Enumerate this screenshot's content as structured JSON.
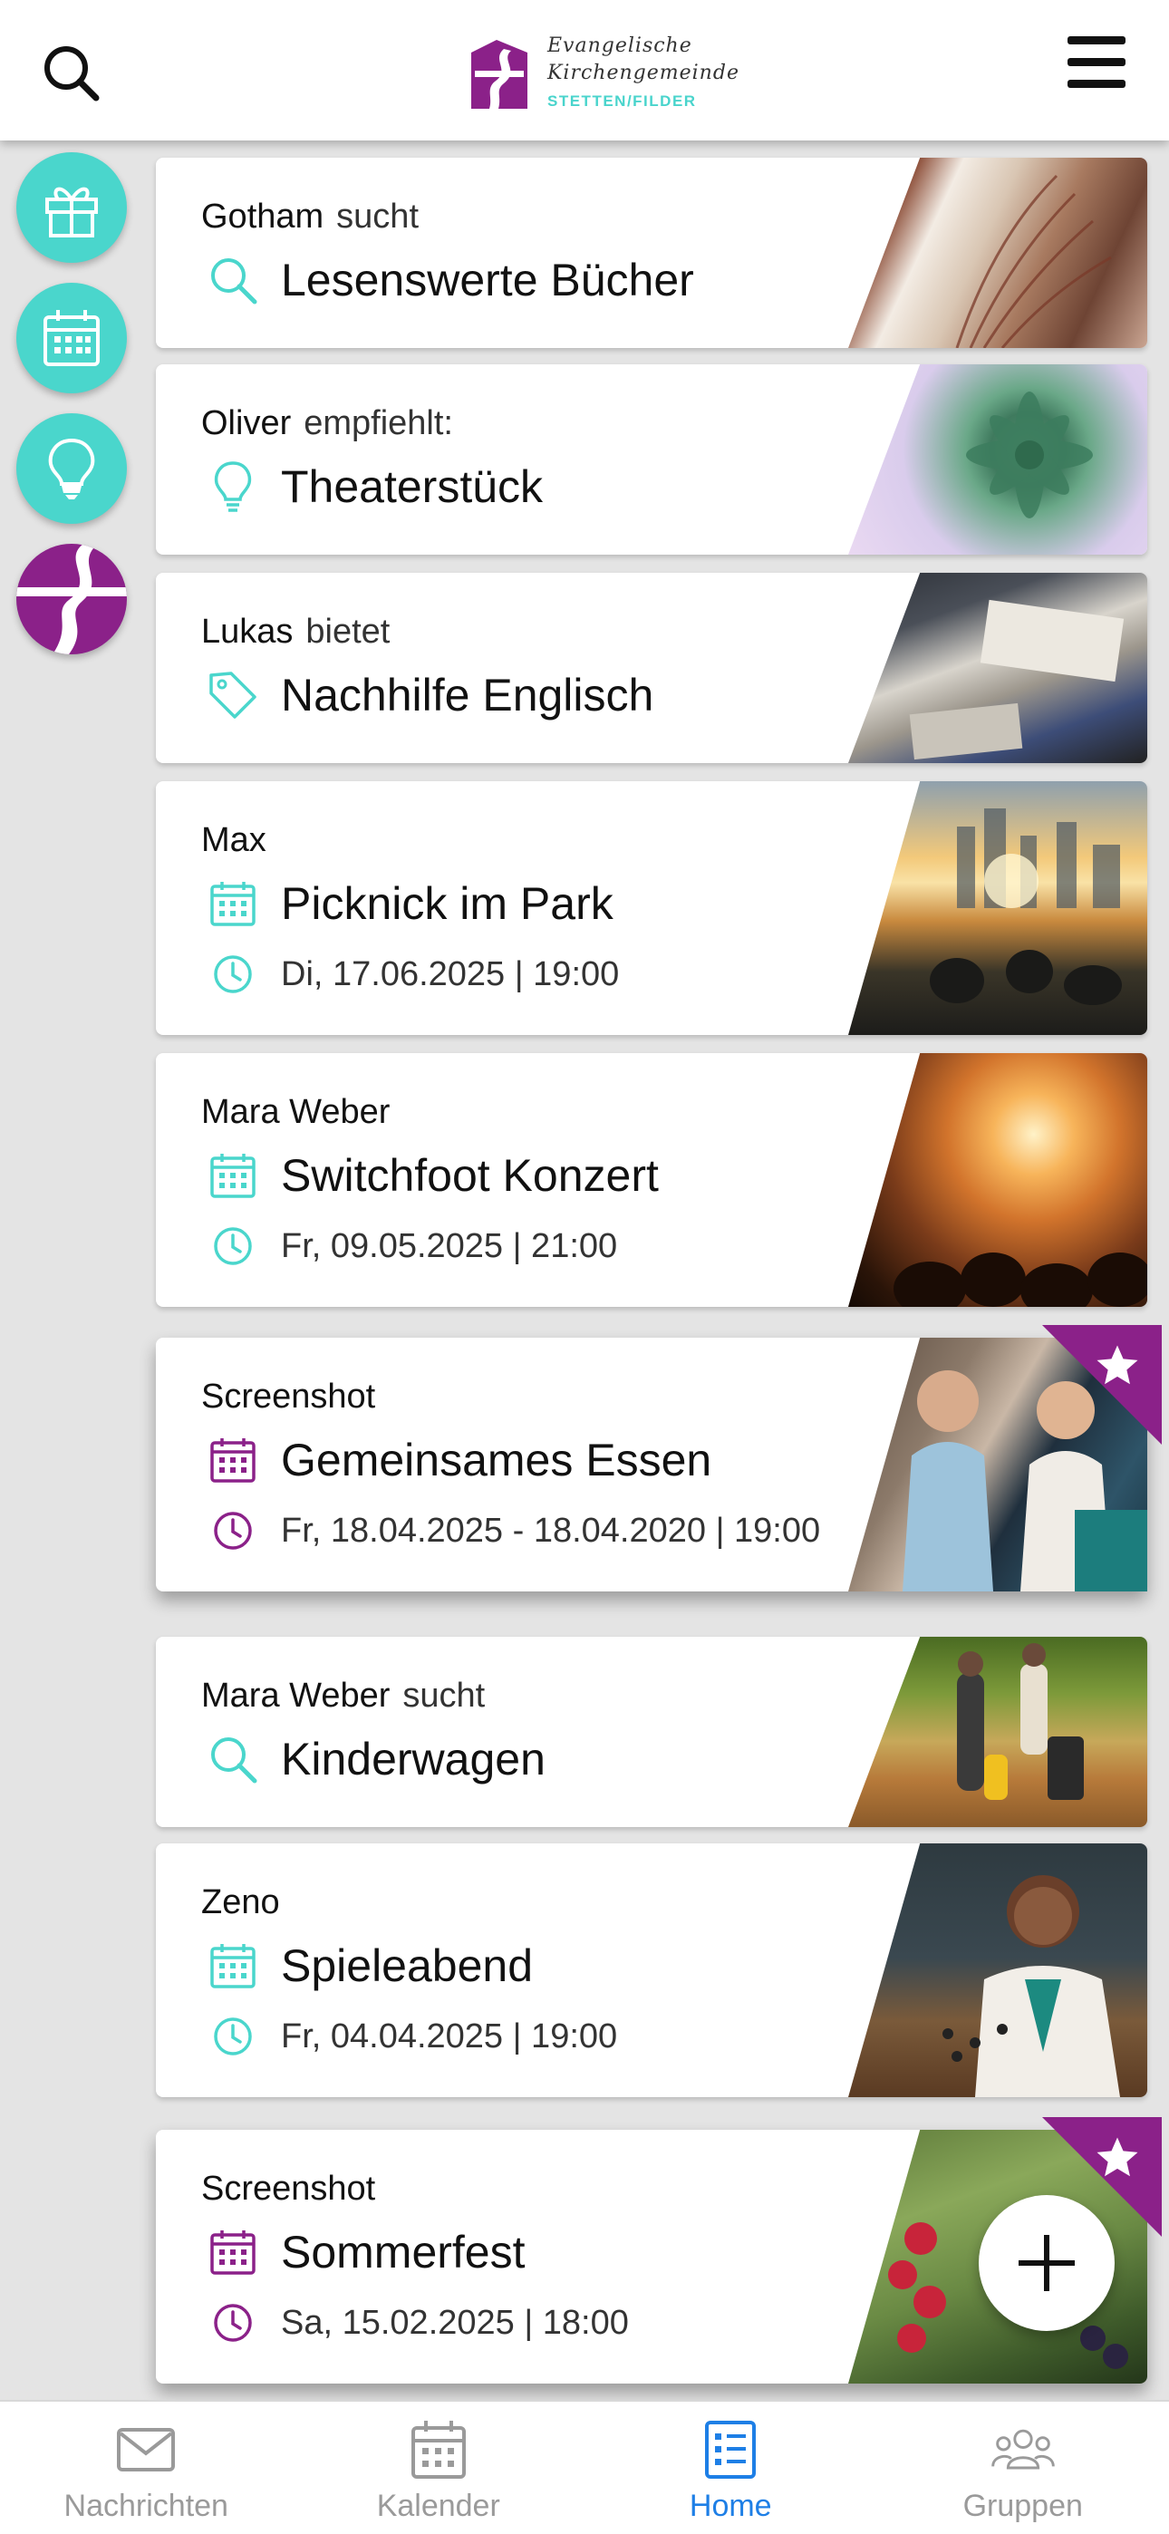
{
  "header": {
    "logo_line1": "Evangelische",
    "logo_line2": "Kirchengemeinde",
    "logo_line3": "STETTEN/FILDER"
  },
  "colors": {
    "teal": "#4ad6cc",
    "purple": "#8b2189",
    "active_blue": "#1e7fe6",
    "inactive_gray": "#9a9a9a"
  },
  "side_filters": [
    "gift-icon",
    "calendar-icon",
    "lightbulb-icon",
    "church-logo-icon"
  ],
  "cards": [
    {
      "author": "Gotham",
      "verb": "sucht",
      "title": "Lesenswerte Bücher",
      "icon": "search-icon"
    },
    {
      "author": "Oliver",
      "verb": "empfiehlt:",
      "title": "Theaterstück",
      "icon": "lightbulb-icon"
    },
    {
      "author": "Lukas",
      "verb": "bietet",
      "title": "Nachhilfe Englisch",
      "icon": "tag-icon"
    },
    {
      "author": "Max",
      "title": "Picknick im Park",
      "date": "Di, 17.06.2025 | 19:00",
      "icon": "calendar-icon"
    },
    {
      "author": "Mara Weber",
      "title": "Switchfoot Konzert",
      "date": "Fr, 09.05.2025 | 21:00",
      "icon": "calendar-icon"
    },
    {
      "author": "Screenshot",
      "title": "Gemeinsames Essen",
      "date": "Fr, 18.04.2025 - 18.04.2020 | 19:00",
      "icon": "calendar-icon",
      "featured": true
    },
    {
      "author": "Mara Weber",
      "verb": "sucht",
      "title": "Kinderwagen",
      "icon": "search-icon"
    },
    {
      "author": "Zeno",
      "title": "Spieleabend",
      "date": "Fr, 04.04.2025 | 19:00",
      "icon": "calendar-icon"
    },
    {
      "author": "Screenshot",
      "title": "Sommerfest",
      "date": "Sa, 15.02.2025 | 18:00",
      "icon": "calendar-icon",
      "featured": true
    }
  ],
  "bottom_nav": [
    {
      "label": "Nachrichten",
      "icon": "envelope-icon"
    },
    {
      "label": "Kalender",
      "icon": "calendar-icon"
    },
    {
      "label": "Home",
      "icon": "list-icon",
      "active": true
    },
    {
      "label": "Gruppen",
      "icon": "group-icon"
    }
  ]
}
